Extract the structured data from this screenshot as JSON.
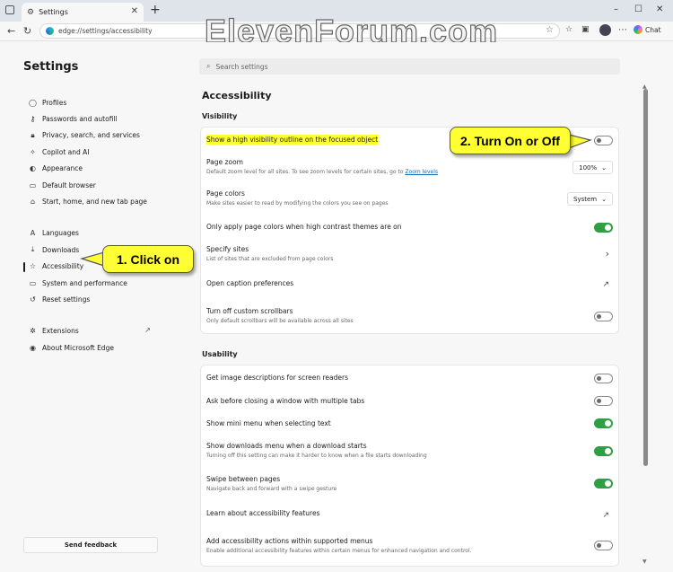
{
  "browser": {
    "tab_title": "Settings",
    "tab_close": "✕",
    "new_tab": "+",
    "url": "edge://settings/accessibility",
    "chat_label": "Chat",
    "window_controls": [
      "–",
      "☐",
      "✕"
    ]
  },
  "watermark": "ElevenForum.com",
  "sidebar": {
    "title": "Settings",
    "search_placeholder": "Search settings",
    "items": [
      {
        "label": "Profiles",
        "icon": "person-icon"
      },
      {
        "label": "Passwords and autofill",
        "icon": "key-icon"
      },
      {
        "label": "Privacy, search, and services",
        "icon": "lock-icon"
      },
      {
        "label": "Copilot and AI",
        "icon": "copilot-icon"
      },
      {
        "label": "Appearance",
        "icon": "palette-icon"
      },
      {
        "label": "Default browser",
        "icon": "browser-icon"
      },
      {
        "label": "Start, home, and new tab page",
        "icon": "home-icon"
      }
    ],
    "items2": [
      {
        "label": "Languages",
        "icon": "languages-icon"
      },
      {
        "label": "Downloads",
        "icon": "download-icon"
      },
      {
        "label": "Accessibility",
        "icon": "accessibility-icon"
      },
      {
        "label": "System and performance",
        "icon": "laptop-icon"
      },
      {
        "label": "Reset settings",
        "icon": "reset-icon"
      }
    ],
    "items3": [
      {
        "label": "Extensions",
        "icon": "puzzle-icon"
      },
      {
        "label": "About Microsoft Edge",
        "icon": "edge-icon"
      }
    ],
    "feedback_label": "Send feedback"
  },
  "main": {
    "title": "Accessibility",
    "visibility": {
      "heading": "Visibility",
      "high_visibility": "Show a high visibility outline on the focused object",
      "page_zoom_title": "Page zoom",
      "page_zoom_desc": "Default zoom level for all sites. To see zoom levels for certain sites, go to",
      "page_zoom_link": "Zoom levels",
      "page_zoom_value": "100%",
      "page_colors_title": "Page colors",
      "page_colors_desc": "Make sites easier to read by modifying the colors you see on pages",
      "page_colors_value": "System",
      "high_contrast_only": "Only apply page colors when high contrast themes are on",
      "specify_sites_title": "Specify sites",
      "specify_sites_desc": "List of sites that are excluded from page colors",
      "caption_prefs": "Open caption preferences",
      "scrollbars_title": "Turn off custom scrollbars",
      "scrollbars_desc": "Only default scrollbars will be available across all sites"
    },
    "usability": {
      "heading": "Usability",
      "image_descriptions": "Get image descriptions for screen readers",
      "ask_before_closing": "Ask before closing a window with multiple tabs",
      "mini_menu": "Show mini menu when selecting text",
      "downloads_menu_title": "Show downloads menu when a download starts",
      "downloads_menu_desc": "Turning off this setting can make it harder to know when a file starts downloading",
      "swipe_title": "Swipe between pages",
      "swipe_desc": "Navigate back and forward with a swipe gesture",
      "learn_more": "Learn about accessibility features",
      "a11y_actions_title": "Add accessibility actions within supported menus",
      "a11y_actions_desc": "Enable additional accessibility features within certain menus for enhanced navigation and control."
    }
  },
  "callouts": {
    "step1": "1. Click on",
    "step2": "2. Turn On or Off"
  },
  "colors": {
    "toggle_on": "#2f9e44",
    "highlight": "#ffff33",
    "link": "#0f6cbd"
  }
}
